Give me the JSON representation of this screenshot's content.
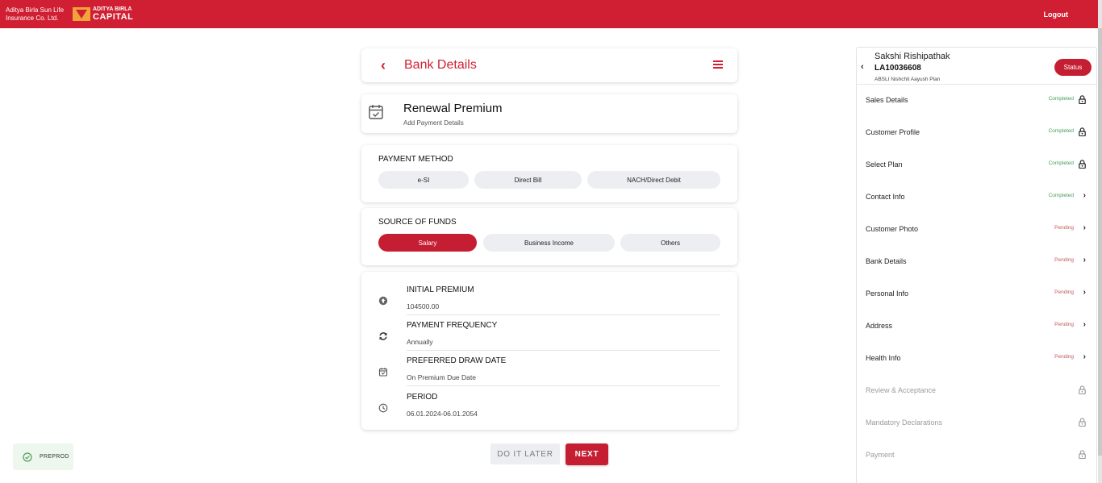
{
  "topbar": {
    "brand_line1": "Aditya Birla Sun Life",
    "brand_line2": "Insurance Co. Ltd.",
    "brand2_small": "ADITYA BIRLA",
    "brand2_big": "CAPITAL",
    "logout": "Logout",
    "bg_color": "#d01f33"
  },
  "header": {
    "back_icon": "chevron-left-icon",
    "title": "Bank Details",
    "menu_icon": "hamburger-icon"
  },
  "renewal": {
    "icon": "calendar-check-icon",
    "title": "Renewal Premium",
    "subtitle": "Add Payment Details"
  },
  "payment_method": {
    "label": "PAYMENT METHOD",
    "options": [
      {
        "label": "e-SI",
        "active": false
      },
      {
        "label": "Direct Bill",
        "active": false
      },
      {
        "label": "NACH/Direct Debit",
        "active": false
      }
    ]
  },
  "source_of_funds": {
    "label": "SOURCE OF FUNDS",
    "options": [
      {
        "label": "Salary",
        "active": true
      },
      {
        "label": "Business Income",
        "active": false
      },
      {
        "label": "Others",
        "active": false
      }
    ]
  },
  "details": [
    {
      "icon": "upload-circle-icon",
      "label": "INITIAL PREMIUM",
      "value": "104500.00"
    },
    {
      "icon": "refresh-icon",
      "label": "PAYMENT FREQUENCY",
      "value": "Annually"
    },
    {
      "icon": "calendar-icon",
      "label": "PREFERRED DRAW DATE",
      "value": "On Premium Due Date"
    },
    {
      "icon": "clock-icon",
      "label": "PERIOD",
      "value": "06.01.2024-06.01.2054"
    }
  ],
  "actions": {
    "later": "DO IT LATER",
    "next": "NEXT"
  },
  "env_badge": {
    "icon": "check-circle-icon",
    "text": "PREPROD"
  },
  "sidebar": {
    "name": "Sakshi Rishipathak",
    "id": "LA10036608",
    "plan": "ABSLI Nishchit Aayush Plan",
    "status_button": "Status",
    "items": [
      {
        "label": "Sales Details",
        "state": "Completed",
        "icon": "lock-icon"
      },
      {
        "label": "Customer Profile",
        "state": "Completed",
        "icon": "lock-icon"
      },
      {
        "label": "Select Plan",
        "state": "Completed",
        "icon": "lock-icon"
      },
      {
        "label": "Contact Info",
        "state": "Completed",
        "icon": "chevron-right-icon"
      },
      {
        "label": "Customer Photo",
        "state": "Pending",
        "icon": "chevron-right-icon"
      },
      {
        "label": "Bank Details",
        "state": "Pending",
        "icon": "chevron-right-icon"
      },
      {
        "label": "Personal Info",
        "state": "Pending",
        "icon": "chevron-right-icon"
      },
      {
        "label": "Address",
        "state": "Pending",
        "icon": "chevron-right-icon"
      },
      {
        "label": "Health Info",
        "state": "Pending",
        "icon": "chevron-right-icon"
      },
      {
        "label": "Review & Acceptance",
        "state": "",
        "icon": "lock-outline-icon"
      },
      {
        "label": "Mandatory Declarations",
        "state": "",
        "icon": "lock-outline-icon"
      },
      {
        "label": "Payment",
        "state": "",
        "icon": "lock-outline-icon"
      }
    ]
  },
  "colors": {
    "primary": "#c51e33",
    "completed": "#4a9e55",
    "pending": "#c15a5a"
  }
}
